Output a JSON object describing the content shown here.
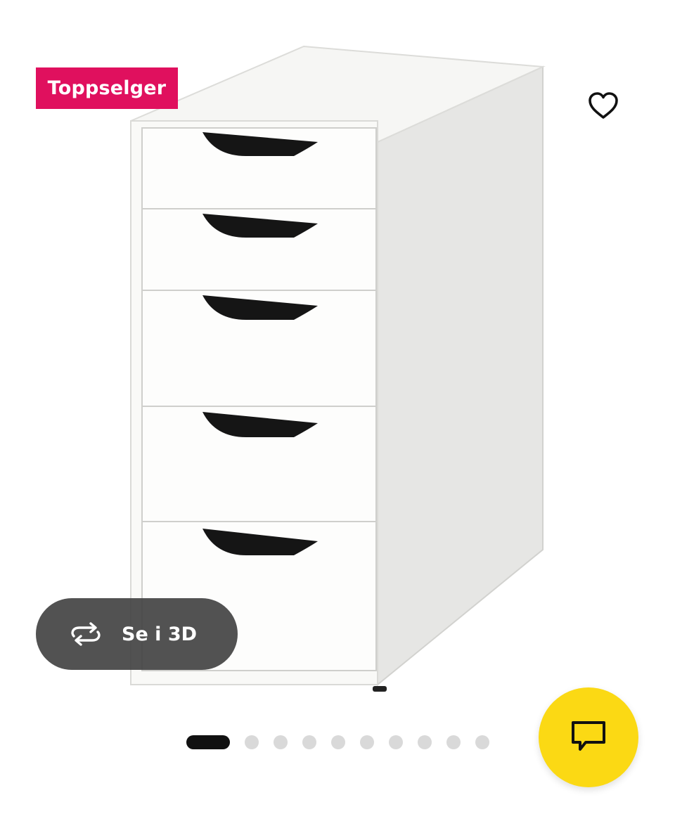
{
  "product": {
    "badge": "Toppselger",
    "image_icon": "drawer-unit-image"
  },
  "actions": {
    "favorite_icon": "heart-outline-icon",
    "view_3d_label": "Se i 3D",
    "view_3d_icon": "rotate-3d-icon",
    "chat_icon": "chat-bubble-icon"
  },
  "carousel": {
    "total_images": 10,
    "active_index": 0
  },
  "colors": {
    "badge_bg": "#e0105e",
    "chat_button_bg": "#fbd914",
    "pill_bg": "#434343",
    "active_dot": "#111111",
    "inactive_dot": "#d9d9d9"
  }
}
